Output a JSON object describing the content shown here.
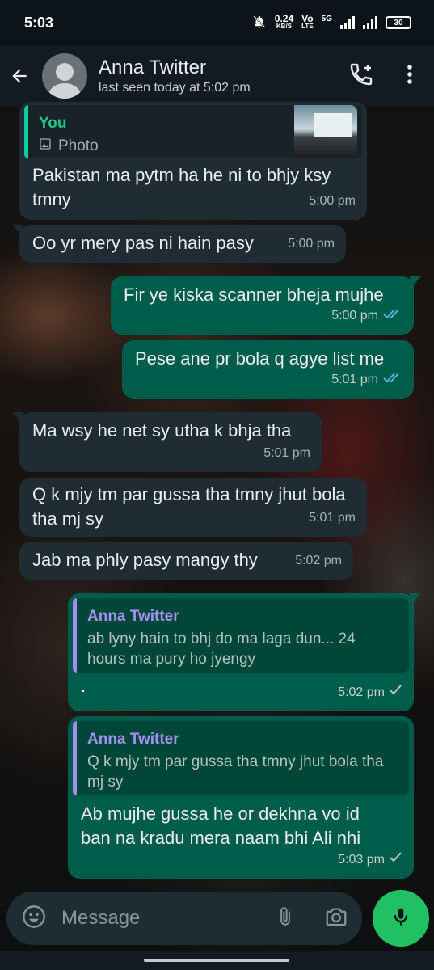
{
  "status_bar": {
    "time": "5:03",
    "net_speed": "0.24",
    "net_unit": "KB/S",
    "vo_label": "Vo",
    "lte_label": "LTE",
    "network": "5G",
    "battery": "30"
  },
  "header": {
    "contact_name": "Anna Twitter",
    "last_seen": "last seen today at 5:02 pm"
  },
  "messages": [
    {
      "direction": "in",
      "reply_author": "You",
      "reply_type": "Photo",
      "text": "Pakistan ma pytm ha he ni to bhjy ksy tmny",
      "time": "5:00 pm"
    },
    {
      "direction": "in",
      "text": "Oo yr mery pas ni hain pasy",
      "time": "5:00 pm"
    },
    {
      "direction": "out",
      "text": "Fir ye kiska scanner bheja mujhe",
      "time": "5:00 pm",
      "status": "read"
    },
    {
      "direction": "out",
      "text": "Pese ane pr bola q agye list me",
      "time": "5:01 pm",
      "status": "read"
    },
    {
      "direction": "in",
      "text": "Ma wsy he net sy utha k bhja tha",
      "time": "5:01 pm"
    },
    {
      "direction": "in",
      "text": "Q k mjy tm par gussa tha tmny jhut bola tha mj sy",
      "time": "5:01 pm"
    },
    {
      "direction": "in",
      "text": "Jab ma phly pasy mangy thy",
      "time": "5:02 pm"
    },
    {
      "direction": "out",
      "reply_author": "Anna Twitter",
      "reply_text": "ab lyny hain to bhj do ma laga dun... 24 hours ma pury ho jyengy",
      "text": ".",
      "time": "5:02 pm",
      "status": "sent"
    },
    {
      "direction": "out",
      "reply_author": "Anna Twitter",
      "reply_text": "Q k mjy tm par gussa tha tmny jhut bola tha mj sy",
      "text": "Ab mujhe gussa he or dekhna vo id ban na kradu mera naam bhi Ali nhi",
      "time": "5:03 pm",
      "status": "sent"
    }
  ],
  "input": {
    "placeholder": "Message"
  },
  "colors": {
    "outgoing_bubble": "#005c4b",
    "incoming_bubble": "#202c33",
    "read_ticks": "#53bdeb",
    "mic_button": "#21c063"
  }
}
